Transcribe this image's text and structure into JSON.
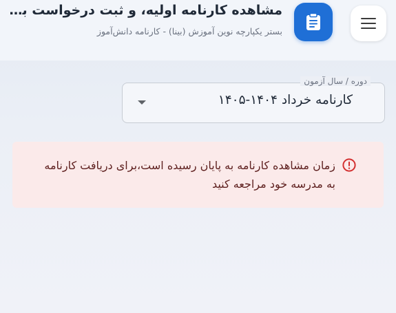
{
  "header": {
    "title": "مشاهده کارنامه اولیه، و ثبت درخواست بر...",
    "subtitle": "بستر یکپارچه نوین آموزش (بینا) - کارنامه دانش‌آموز"
  },
  "term_select": {
    "label": "دوره / سال آزمون",
    "value": "کارنامه خرداد ۱۴۰۴-۱۴۰۵"
  },
  "alert": {
    "message": "زمان مشاهده کارنامه به پایان رسیده است،برای دریافت کارنامه به مدرسه خود مراجعه کنید"
  },
  "icons": {
    "menu": "menu-icon",
    "report": "clipboard-icon",
    "alert": "error-circle-icon",
    "dropdown": "chevron-down-icon"
  },
  "colors": {
    "primary": "#1f6fd6",
    "alert_bg": "#fbeaea",
    "alert_icon": "#d32f2f",
    "alert_text": "#5f2120"
  }
}
